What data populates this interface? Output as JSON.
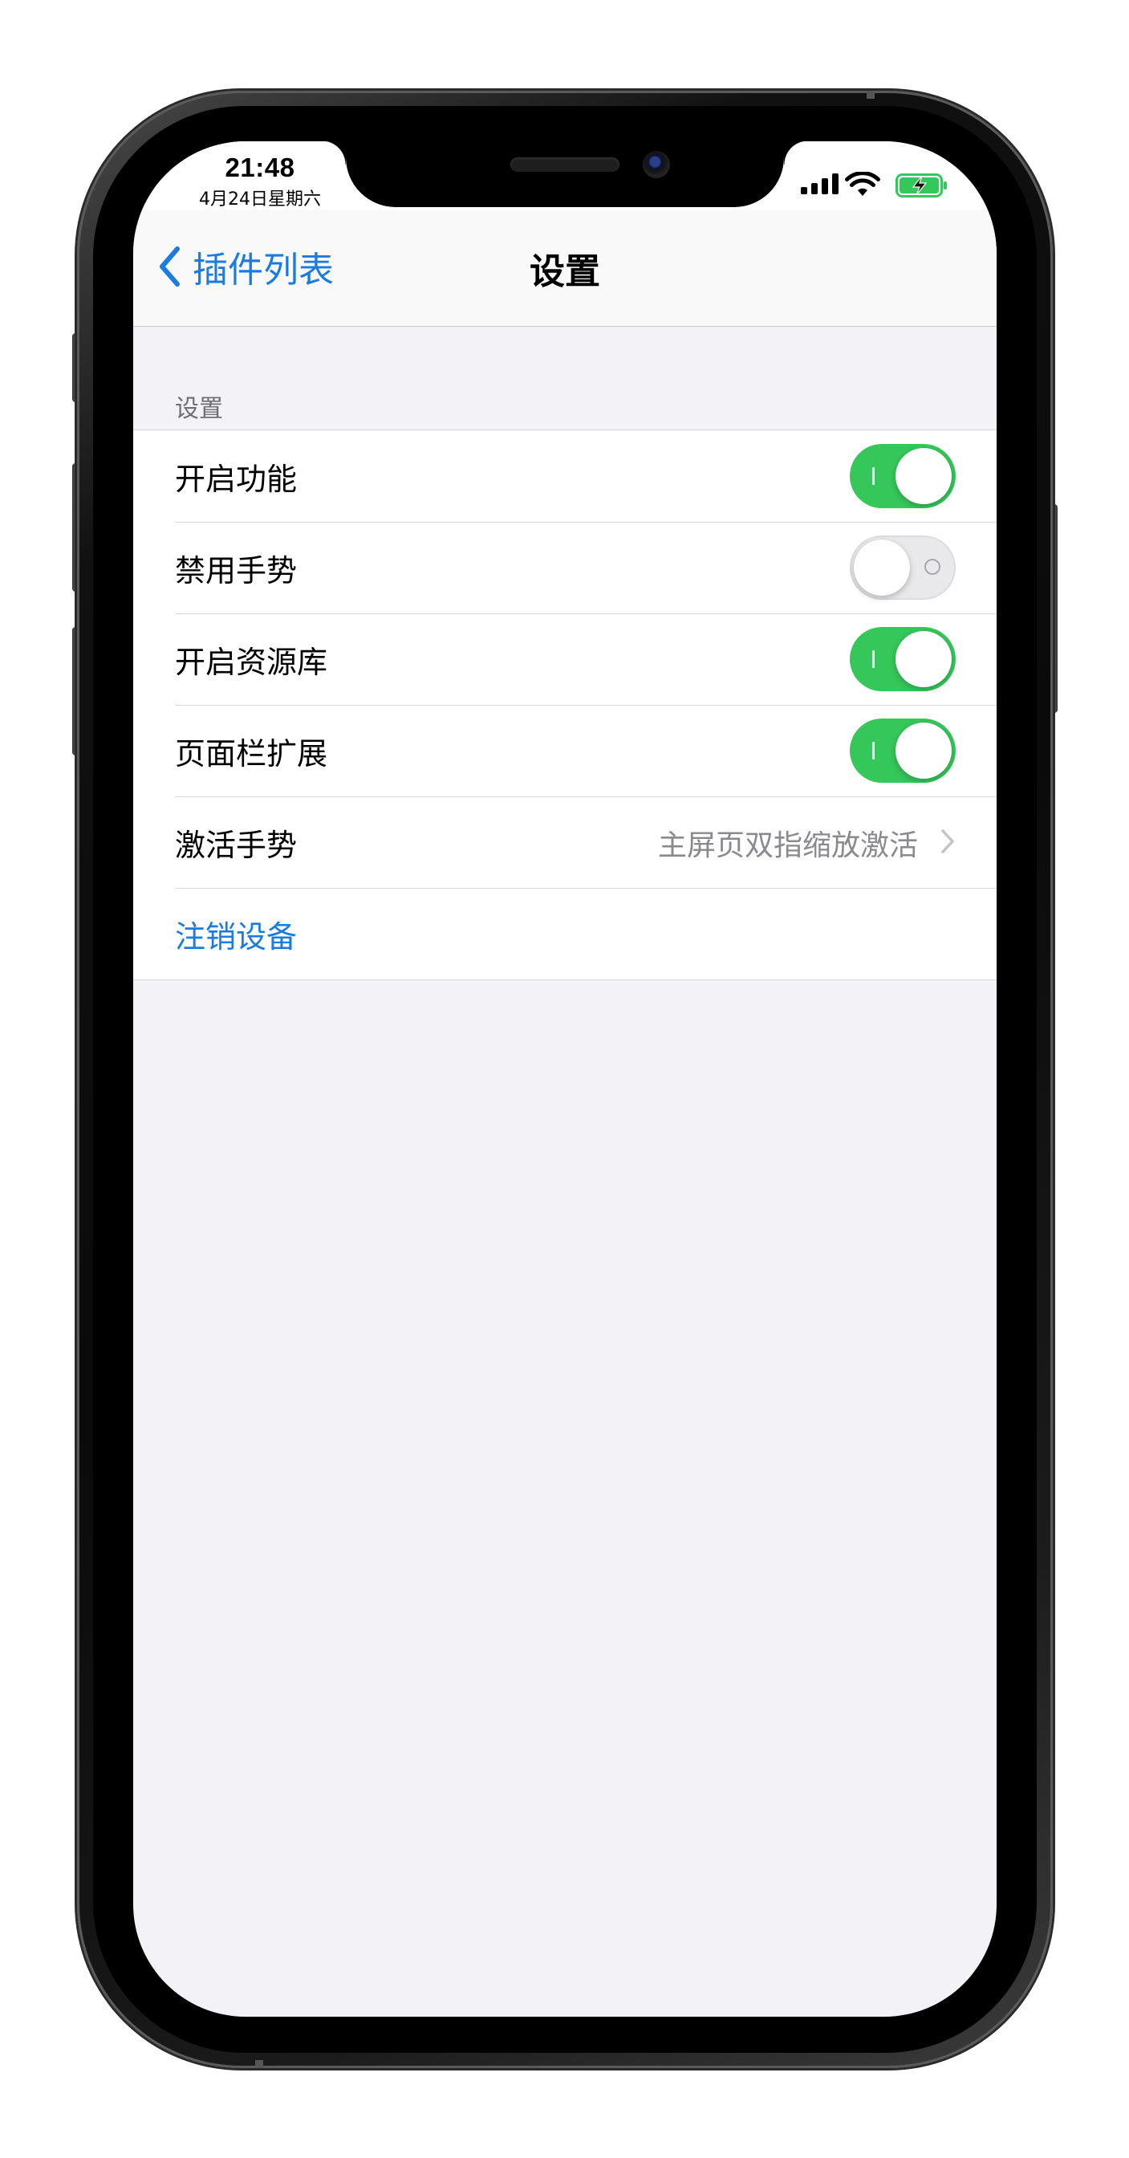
{
  "status_bar": {
    "time": "21:48",
    "date": "4月24日星期六",
    "icons": [
      "cellular-signal-icon",
      "wifi-icon",
      "battery-charging-icon"
    ]
  },
  "nav": {
    "back_label": "插件列表",
    "title": "设置"
  },
  "section": {
    "header": "设置",
    "rows": [
      {
        "label": "开启功能",
        "type": "toggle",
        "on": true
      },
      {
        "label": "禁用手势",
        "type": "toggle",
        "on": false
      },
      {
        "label": "开启资源库",
        "type": "toggle",
        "on": true
      },
      {
        "label": "页面栏扩展",
        "type": "toggle",
        "on": true
      },
      {
        "label": "激活手势",
        "type": "disclosure",
        "value": "主屏页双指缩放激活"
      },
      {
        "label": "注销设备",
        "type": "action"
      }
    ]
  },
  "colors": {
    "accent_blue": "#1a7be0",
    "toggle_on_green": "#35c759",
    "background_gray": "#f2f2f7"
  }
}
